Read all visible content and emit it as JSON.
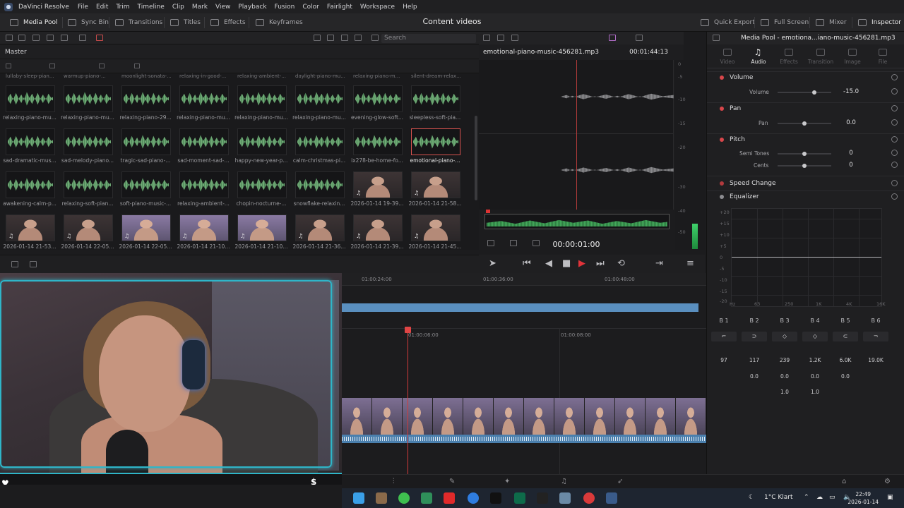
{
  "menubar": {
    "app_name": "DaVinci Resolve",
    "items": [
      "File",
      "Edit",
      "Trim",
      "Timeline",
      "Clip",
      "Mark",
      "View",
      "Playback",
      "Fusion",
      "Color",
      "Fairlight",
      "Workspace",
      "Help"
    ]
  },
  "toolbar": {
    "media_pool": "Media Pool",
    "sync_bin": "Sync Bin",
    "transitions": "Transitions",
    "titles": "Titles",
    "effects": "Effects",
    "keyframes": "Keyframes",
    "project_title": "Content videos",
    "quick_export": "Quick Export",
    "full_screen": "Full Screen",
    "mixer": "Mixer",
    "inspector": "Inspector"
  },
  "media_pool": {
    "search_placeholder": "Search",
    "bin": "Master",
    "cut_labels": [
      "lullaby-sleep-pian...",
      "warmup-piano-...",
      "moonlight-sonata-...",
      "relaxing-in-good-...",
      "relaxing-ambient-...",
      "daylight-piano-mu...",
      "relaxing-piano-m...",
      "silent-dream-relax..."
    ],
    "clips": [
      {
        "label": "relaxing-piano-mu...",
        "kind": "audio"
      },
      {
        "label": "relaxing-piano-mu...",
        "kind": "audio"
      },
      {
        "label": "relaxing-piano-29...",
        "kind": "audio"
      },
      {
        "label": "relaxing-piano-mu...",
        "kind": "audio"
      },
      {
        "label": "relaxing-piano-mu...",
        "kind": "audio"
      },
      {
        "label": "relaxing-piano-mu...",
        "kind": "audio"
      },
      {
        "label": "evening-glow-soft...",
        "kind": "audio"
      },
      {
        "label": "sleepless-soft-pia...",
        "kind": "audio"
      },
      {
        "label": "sad-dramatic-mus...",
        "kind": "audio"
      },
      {
        "label": "sad-melody-piano...",
        "kind": "audio"
      },
      {
        "label": "tragic-sad-piano-...",
        "kind": "audio"
      },
      {
        "label": "sad-moment-sad-...",
        "kind": "audio"
      },
      {
        "label": "happy-new-year-p...",
        "kind": "audio"
      },
      {
        "label": "calm-christmas-pi...",
        "kind": "audio"
      },
      {
        "label": "ix278-be-home-fo...",
        "kind": "audio"
      },
      {
        "label": "emotional-piano-...",
        "kind": "audio",
        "selected": true
      },
      {
        "label": "awakening-calm-p...",
        "kind": "audio"
      },
      {
        "label": "relaxing-soft-pian...",
        "kind": "audio"
      },
      {
        "label": "soft-piano-music-...",
        "kind": "audio"
      },
      {
        "label": "relaxing-ambient-...",
        "kind": "audio"
      },
      {
        "label": "chopin-nocturne-...",
        "kind": "audio"
      },
      {
        "label": "snowflake-relaxin...",
        "kind": "audio"
      },
      {
        "label": "2026-01-14 19-39...",
        "kind": "video"
      },
      {
        "label": "2026-01-14 21-58...",
        "kind": "video"
      },
      {
        "label": "2026-01-14 21-53...",
        "kind": "video"
      },
      {
        "label": "2026-01-14 22-05...",
        "kind": "video"
      },
      {
        "label": "2026-01-14 22-05...",
        "kind": "video_light"
      },
      {
        "label": "2026-01-14 21-10...",
        "kind": "video_light"
      },
      {
        "label": "2026-01-14 21-10...",
        "kind": "video_light"
      },
      {
        "label": "2026-01-14 21-36...",
        "kind": "video"
      },
      {
        "label": "2026-01-14 21-39...",
        "kind": "video"
      },
      {
        "label": "2026-01-14 21-45...",
        "kind": "video"
      }
    ]
  },
  "viewer": {
    "clip_name": "emotional-piano-music-456281.mp3",
    "duration": "00:01:44:13",
    "timecode": "00:00:01:00",
    "meter_ticks": [
      "0",
      "-5",
      "-10",
      "-15",
      "-20",
      "-30",
      "-40",
      "-50"
    ]
  },
  "timeline": {
    "ruler_top": [
      "01:00:24:00",
      "01:00:36:00",
      "01:00:48:00"
    ],
    "ruler_zoom": [
      "01:00:06:00",
      "01:00:08:00"
    ]
  },
  "inspector": {
    "header": "Media Pool - emotiona...iano-music-456281.mp3",
    "tabs": [
      "Video",
      "Audio",
      "Effects",
      "Transition",
      "Image",
      "File"
    ],
    "active_tab": "Audio",
    "volume": {
      "title": "Volume",
      "label": "Volume",
      "value": "-15.0"
    },
    "pan": {
      "title": "Pan",
      "label": "Pan",
      "value": "0.0"
    },
    "pitch": {
      "title": "Pitch",
      "semitones_label": "Semi Tones",
      "semitones": "0",
      "cents_label": "Cents",
      "cents": "0"
    },
    "speed_change": "Speed Change",
    "equalizer": "Equalizer",
    "eq_db": [
      "+20",
      "+15",
      "+10",
      "+5",
      "0",
      "-5",
      "-10",
      "-15",
      "-20"
    ],
    "eq_freq": [
      "Hz",
      "63",
      "250",
      "1K",
      "4K",
      "16K"
    ],
    "bands": [
      {
        "name": "B 1",
        "shape": "⌐",
        "freq": "97",
        "gain": "",
        "q": ""
      },
      {
        "name": "B 2",
        "shape": "⊃",
        "freq": "117",
        "gain": "0.0",
        "q": ""
      },
      {
        "name": "B 3",
        "shape": "◇",
        "freq": "239",
        "gain": "0.0",
        "q": "1.0"
      },
      {
        "name": "B 4",
        "shape": "◇",
        "freq": "1.2K",
        "gain": "0.0",
        "q": "1.0"
      },
      {
        "name": "B 5",
        "shape": "⊂",
        "freq": "6.0K",
        "gain": "0.0",
        "q": ""
      },
      {
        "name": "B 6",
        "shape": "¬",
        "freq": "19.0K",
        "gain": "",
        "q": ""
      }
    ]
  },
  "taskbar": {
    "weather": "1°C  Klart",
    "time": "22:49",
    "date": "2026-01-14"
  }
}
